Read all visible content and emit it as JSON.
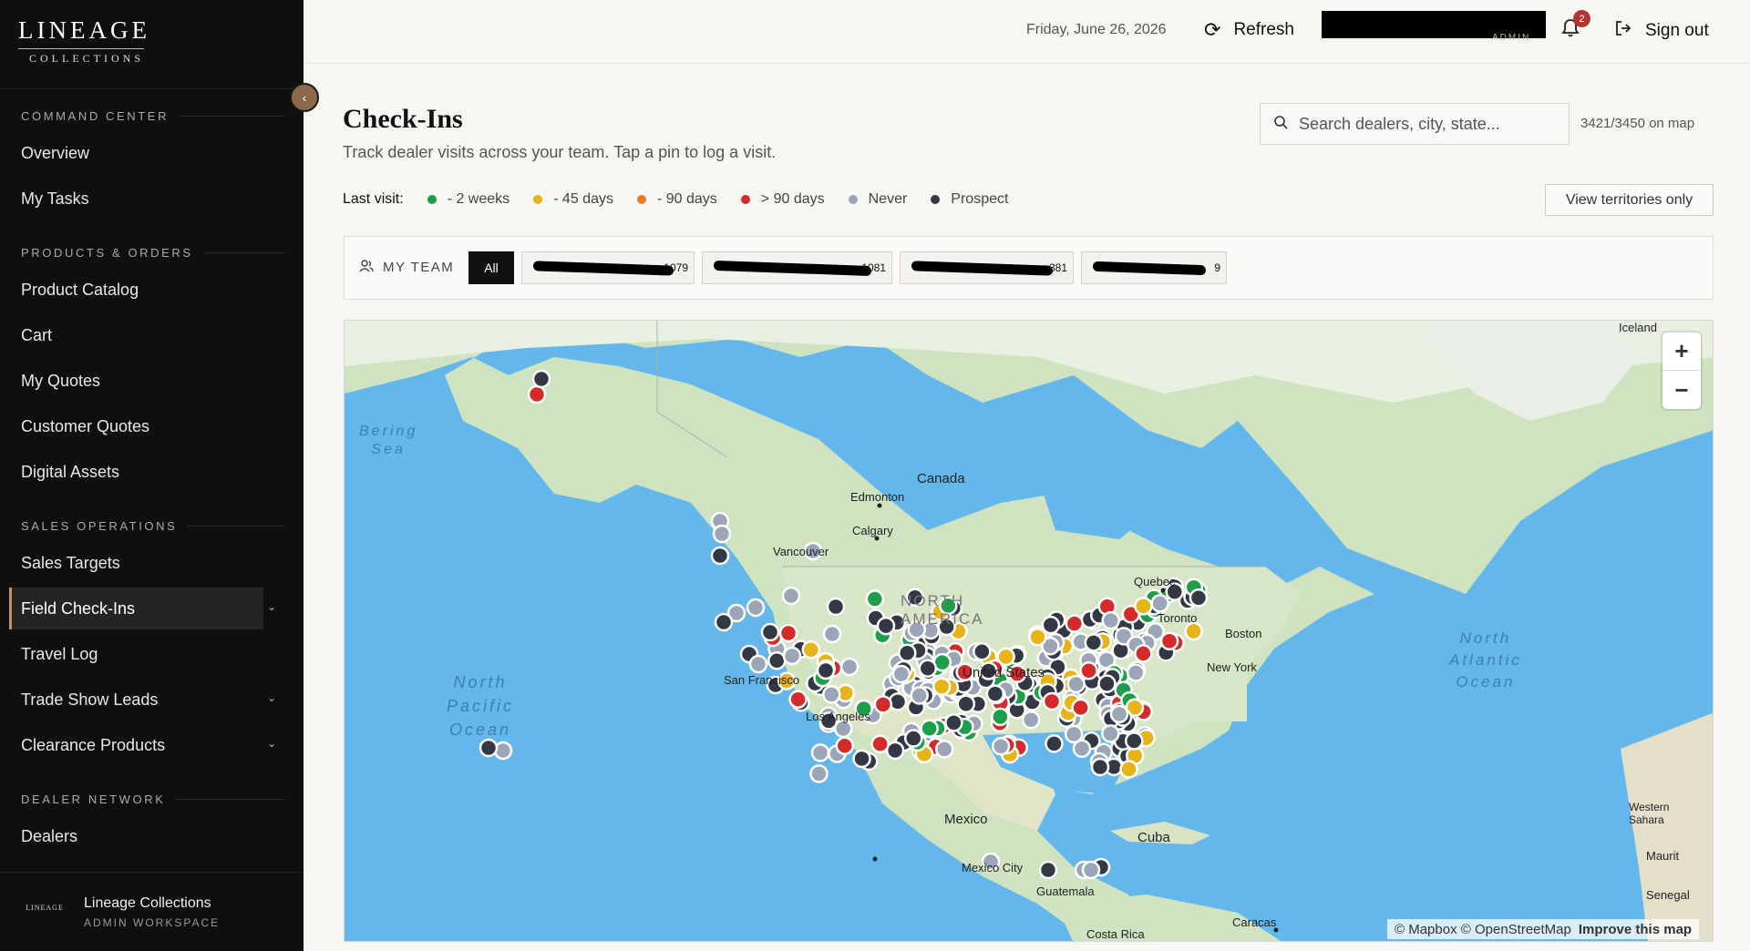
{
  "brand": {
    "name": "LINEAGE",
    "sub": "COLLECTIONS"
  },
  "sidebar": {
    "sections": [
      {
        "title": "COMMAND CENTER",
        "items": [
          "Overview",
          "My Tasks"
        ]
      },
      {
        "title": "PRODUCTS & ORDERS",
        "items": [
          "Product Catalog",
          "Cart",
          "My Quotes",
          "Customer Quotes",
          "Digital Assets"
        ]
      },
      {
        "title": "SALES OPERATIONS",
        "items": [
          "Sales Targets",
          "Field Check-Ins",
          "Travel Log",
          "Trade Show Leads",
          "Clearance Products"
        ]
      },
      {
        "title": "DEALER NETWORK",
        "items": [
          "Dealers"
        ]
      }
    ],
    "active_item": "Field Check-Ins",
    "footer": {
      "logo_text": "LINEAGE",
      "name": "Lineage Collections",
      "sub": "ADMIN WORKSPACE"
    }
  },
  "header": {
    "date": "Friday, June 26, 2026",
    "refresh_label": "Refresh",
    "user_role": "ADMIN",
    "notification_count": "2",
    "signout_label": "Sign out"
  },
  "page": {
    "title": "Check-Ins",
    "subtitle": "Track dealer visits across your team. Tap a pin to log a visit.",
    "search_placeholder": "Search dealers, city, state...",
    "map_count": "3421/3450 on map",
    "territories_button": "View territories only"
  },
  "legend": {
    "label": "Last visit:",
    "items": [
      {
        "label": "- 2 weeks",
        "color": "#1e9e4a"
      },
      {
        "label": "- 45 days",
        "color": "#e6b418"
      },
      {
        "label": "- 90 days",
        "color": "#ee7a22"
      },
      {
        "label": "> 90 days",
        "color": "#d42a2a"
      },
      {
        "label": "Never",
        "color": "#9aa6b8"
      },
      {
        "label": "Prospect",
        "color": "#323844"
      }
    ]
  },
  "team": {
    "label": "MY TEAM",
    "all_label": "All",
    "members": [
      {
        "tail": "1079"
      },
      {
        "tail": "1081"
      },
      {
        "tail": "381"
      },
      {
        "tail": "9"
      }
    ]
  },
  "map": {
    "labels": {
      "canada": "Canada",
      "edmonton": "Edmonton",
      "calgary": "Calgary",
      "vancouver": "Vancouver",
      "north_america": "NORTH\nAMERICA",
      "united_states": "United States",
      "san_francisco": "San Francisco",
      "los_angeles": "Los Angeles",
      "new_york": "New York",
      "boston": "Boston",
      "quebec": "Quebec",
      "toronto": "Toronto",
      "mexico": "Mexico",
      "mexico_city": "Mexico City",
      "cuba": "Cuba",
      "guatemala": "Guatemala",
      "caracas": "Caracas",
      "costa_rica": "Costa Rica",
      "iceland": "Iceland",
      "western_sahara": "Western\nSahara",
      "mauritania": "Maurit",
      "senegal": "Senegal",
      "bering_sea": "Bering\nSea",
      "north_pacific": "North\nPacific\nOcean",
      "north_atlantic": "North\nAtlantic\nOcean"
    },
    "attribution": "© Mapbox © OpenStreetMap",
    "improve": "Improve this map"
  }
}
